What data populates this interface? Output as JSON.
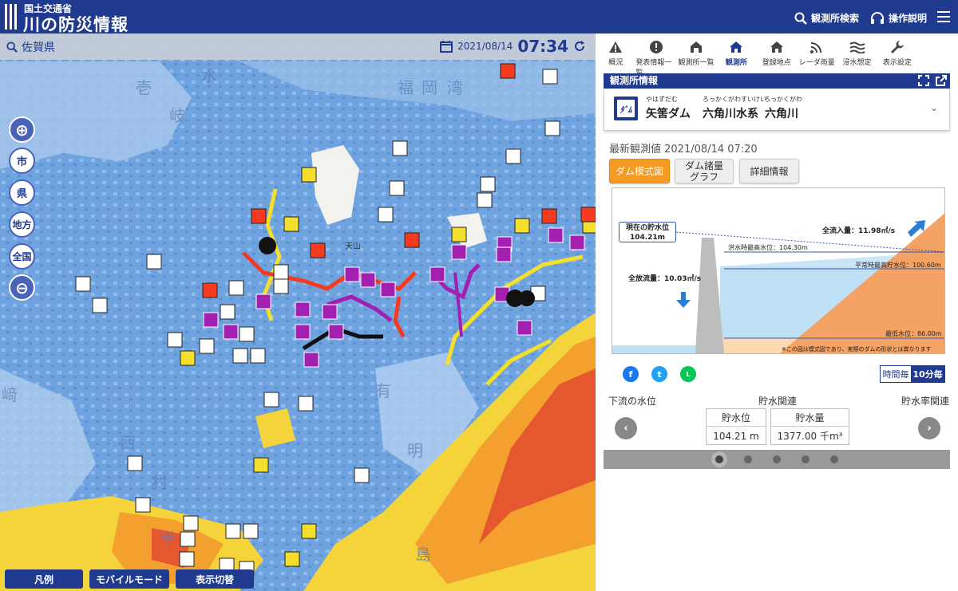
{
  "header": {
    "ministry": "国土交通省",
    "title": "川の防災情報",
    "search_label": "観測所検索",
    "help_label": "操作説明"
  },
  "map": {
    "prefecture": "佐賀県",
    "date": "2021/08/14",
    "time": "07:34",
    "controls": [
      "市",
      "県",
      "地方",
      "全国"
    ],
    "footer_buttons": [
      "凡例",
      "モバイルモード",
      "表示切替"
    ],
    "place_labels": [
      "壱",
      "岐",
      "水",
      "福",
      "岡",
      "湾",
      "天山",
      "有",
      "明",
      "西",
      "村",
      "半",
      "島",
      "﨑"
    ]
  },
  "tabs": [
    {
      "label": "概況",
      "icon": "warning-icon"
    },
    {
      "label": "発表情報一覧",
      "icon": "alert-icon"
    },
    {
      "label": "観測所一覧",
      "icon": "station-list-icon"
    },
    {
      "label": "観測所",
      "icon": "home-icon",
      "active": true
    },
    {
      "label": "登録地点",
      "icon": "home-plus-icon"
    },
    {
      "label": "レーダ雨量",
      "icon": "radar-icon"
    },
    {
      "label": "浸水想定",
      "icon": "flood-icon"
    },
    {
      "label": "表示設定",
      "icon": "wrench-icon"
    }
  ],
  "panel": {
    "section_title": "観測所情報",
    "station": {
      "ruby_name": "やはずだむ",
      "name": "矢筈ダム",
      "ruby_system": "ろっかくがわすいけい",
      "system": "六角川水系",
      "ruby_river": "ろっかくがわ",
      "river": "六角川",
      "icon_text": "ﾀﾞﾑ"
    },
    "latest": "最新観測値 2021/08/14 07:20",
    "buttons": {
      "dam_diagram": "ダム模式図",
      "dam_graph_1": "ダム諸量",
      "dam_graph_2": "グラフ",
      "detail": "詳細情報"
    },
    "diagram": {
      "current_level_title": "現在の貯水位",
      "current_level_value": "104.21m",
      "inflow": "全流入量：11.98㎥/s",
      "outflow": "全放流量：10.03㎥/s",
      "flood_max": "洪水時最高水位：104.30m",
      "normal_max": "平常時最高貯水位：100.60m",
      "min_level": "最低水位：86.00m",
      "note": "※この図は模式図であり、実際のダムの形状とは異なります"
    },
    "toggle": {
      "hourly": "時間毎",
      "ten_min": "10分毎"
    },
    "carousel": {
      "left": "下流の水位",
      "center": "貯水関連",
      "right": "貯水率関連",
      "cards": [
        {
          "key": "貯水位",
          "value": "104.21 m"
        },
        {
          "key": "貯水量",
          "value": "1377.00 千m³"
        }
      ]
    },
    "colors": {
      "primary": "#1f3a8f",
      "accent": "#f59a23"
    }
  }
}
